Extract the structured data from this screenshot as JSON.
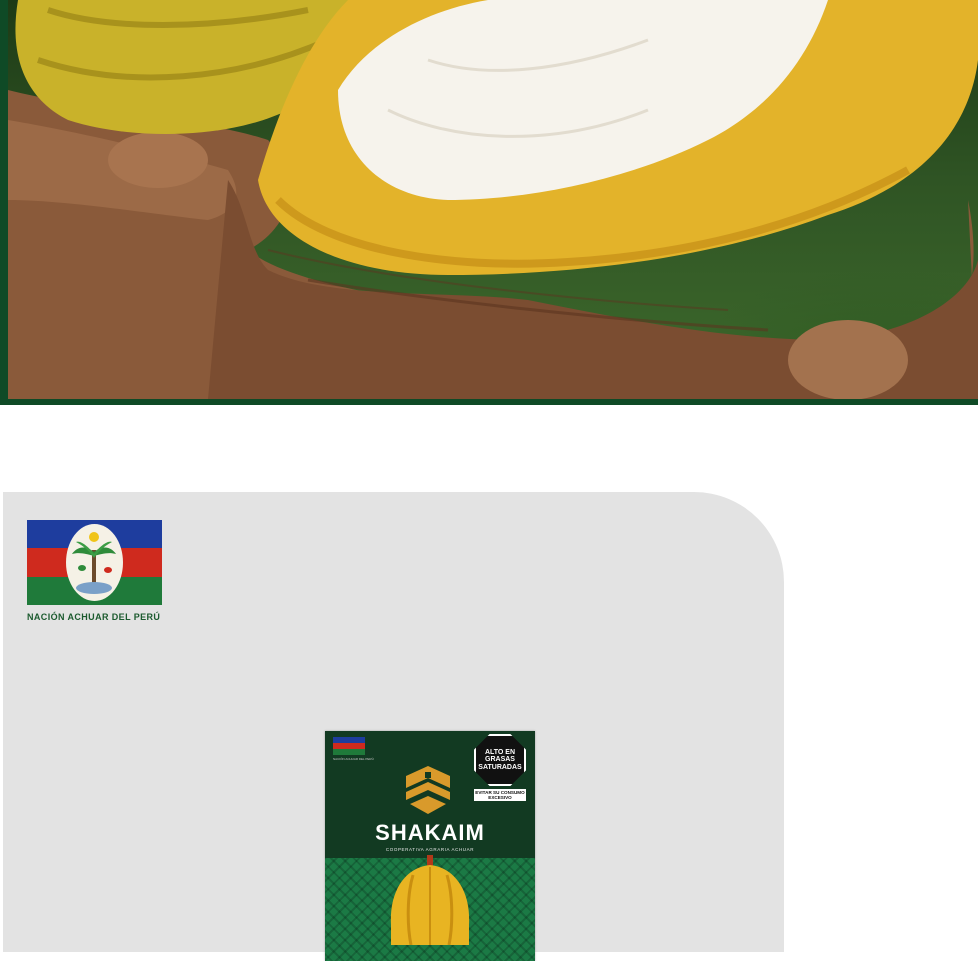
{
  "hero": {
    "image_alt": "",
    "border_color": "#0f4a26"
  },
  "brand": {
    "caption": "NACIÓN ACHUAR DEL PERÚ",
    "flag_colors": [
      "#1e3d9e",
      "#cf2a1e",
      "#1f7a3a"
    ],
    "seal_icon": "palm-tree-seal-icon"
  },
  "product": {
    "name": "SHAKAIM",
    "subtitle": "COOPERATIVA AGRARIA ACHUAR",
    "mini_caption": "NACIÓN ACHUAR DEL PERÚ",
    "warning": {
      "label": "ALTO EN GRASAS SATURADAS",
      "note": "EVITAR SU CONSUMO EXCESIVO"
    },
    "logo_icon": "geometric-shield-logo-icon",
    "accent_color": "#d99a2b"
  }
}
